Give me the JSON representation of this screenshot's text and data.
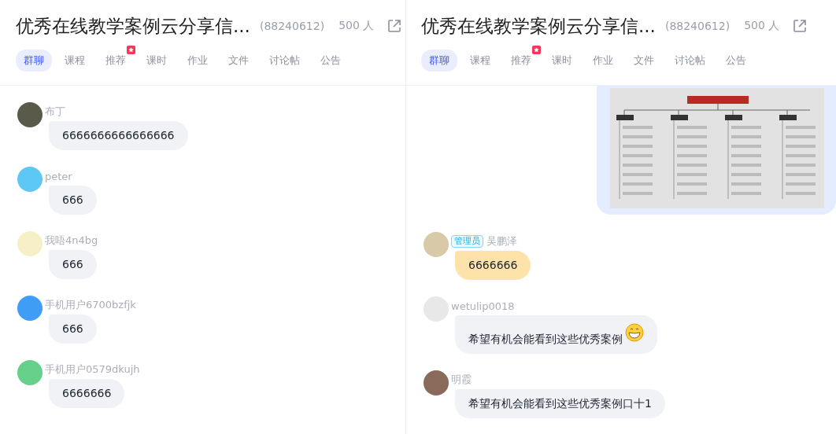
{
  "panes": [
    {
      "header": {
        "title": "优秀在线教学案例云分享信...",
        "group_id": "(88240612)",
        "member_count": "500 人"
      },
      "tabs": [
        {
          "label": "群聊",
          "selected": true,
          "badge": false
        },
        {
          "label": "课程",
          "selected": false,
          "badge": false
        },
        {
          "label": "推荐",
          "selected": false,
          "badge": true
        },
        {
          "label": "课时",
          "selected": false,
          "badge": false
        },
        {
          "label": "作业",
          "selected": false,
          "badge": false
        },
        {
          "label": "文件",
          "selected": false,
          "badge": false
        },
        {
          "label": "讨论帖",
          "selected": false,
          "badge": false
        },
        {
          "label": "公告",
          "selected": false,
          "badge": false
        }
      ],
      "messages": [
        {
          "kind": "text",
          "sender": "布丁",
          "text": "6666666666666666",
          "highlighted": false,
          "emoji": false
        },
        {
          "kind": "text",
          "sender": "peter",
          "text": "666",
          "highlighted": false,
          "emoji": false
        },
        {
          "kind": "text",
          "sender": "我唔4n4bg",
          "text": "666",
          "highlighted": false,
          "emoji": false
        },
        {
          "kind": "text",
          "sender": "手机用户6700bzfjk",
          "text": "666",
          "highlighted": false,
          "emoji": false
        },
        {
          "kind": "text",
          "sender": "手机用户0579dkujh",
          "text": "6666666",
          "highlighted": false,
          "emoji": false
        }
      ]
    },
    {
      "header": {
        "title": "优秀在线教学案例云分享信...",
        "group_id": "(88240612)",
        "member_count": "500 人"
      },
      "tabs": [
        {
          "label": "群聊",
          "selected": true,
          "badge": false
        },
        {
          "label": "课程",
          "selected": false,
          "badge": false
        },
        {
          "label": "推荐",
          "selected": false,
          "badge": true
        },
        {
          "label": "课时",
          "selected": false,
          "badge": false
        },
        {
          "label": "作业",
          "selected": false,
          "badge": false
        },
        {
          "label": "文件",
          "selected": false,
          "badge": false
        },
        {
          "label": "讨论帖",
          "selected": false,
          "badge": false
        },
        {
          "label": "公告",
          "selected": false,
          "badge": false
        }
      ],
      "messages": [
        {
          "kind": "image",
          "outgoing": true
        },
        {
          "kind": "text",
          "sender": "吴鹏泽",
          "role_badge": "管理员",
          "text": "6666666",
          "highlighted": true,
          "emoji": false
        },
        {
          "kind": "text",
          "sender": "wetulip0018",
          "text": "希望有机会能看到这些优秀案例",
          "highlighted": false,
          "emoji": true
        },
        {
          "kind": "text",
          "sender": "明霞",
          "text": "希望有机会能看到这些优秀案例口十1",
          "highlighted": false,
          "emoji": false
        }
      ]
    }
  ]
}
